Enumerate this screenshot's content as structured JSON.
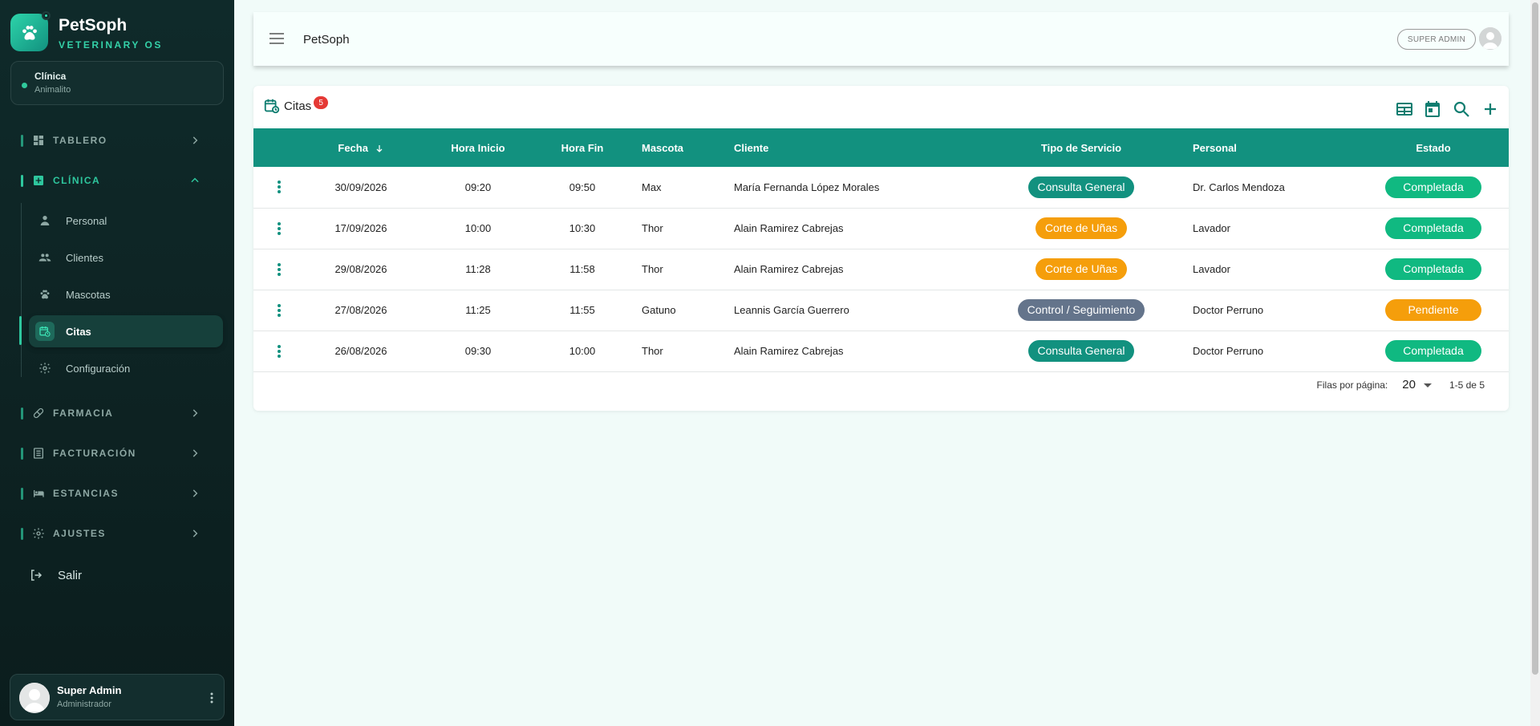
{
  "brand": {
    "name": "PetSoph",
    "subtitle": "VETERINARY OS"
  },
  "clinic": {
    "label": "Clínica",
    "name": "Animalito"
  },
  "nav": {
    "sections": [
      {
        "label": "TABLERO",
        "icon": "dashboard-icon",
        "expanded": false
      },
      {
        "label": "CLÍNICA",
        "icon": "medical-plus-icon",
        "expanded": true
      },
      {
        "label": "FARMACIA",
        "icon": "pill-icon",
        "expanded": false
      },
      {
        "label": "FACTURACIÓN",
        "icon": "receipt-icon",
        "expanded": false
      },
      {
        "label": "ESTANCIAS",
        "icon": "bed-icon",
        "expanded": false
      },
      {
        "label": "AJUSTES",
        "icon": "gear-icon",
        "expanded": false
      }
    ],
    "clinic_items": [
      {
        "label": "Personal",
        "icon": "person-icon"
      },
      {
        "label": "Clientes",
        "icon": "people-icon"
      },
      {
        "label": "Mascotas",
        "icon": "paw-icon"
      },
      {
        "label": "Citas",
        "icon": "calendar-clock-icon",
        "active": true
      },
      {
        "label": "Configuración",
        "icon": "gear-icon"
      }
    ],
    "logout": "Salir"
  },
  "user": {
    "name": "Super Admin",
    "role": "Administrador"
  },
  "topbar": {
    "title": "PetSoph",
    "role_chip": "SUPER ADMIN"
  },
  "card": {
    "title": "Citas",
    "badge": "5",
    "tools": [
      "table-view-icon",
      "calendar-view-icon",
      "search-icon",
      "add-icon"
    ]
  },
  "table": {
    "headers": {
      "fecha": "Fecha",
      "hora_inicio": "Hora Inicio",
      "hora_fin": "Hora Fin",
      "mascota": "Mascota",
      "cliente": "Cliente",
      "tipo": "Tipo de Servicio",
      "personal": "Personal",
      "estado": "Estado"
    },
    "sort": {
      "column": "fecha",
      "direction": "desc"
    },
    "rows": [
      {
        "fecha": "30/09/2026",
        "hora_inicio": "09:20",
        "hora_fin": "09:50",
        "mascota": "Max",
        "cliente": "María Fernanda López Morales",
        "tipo": "Consulta General",
        "tipo_color": "#12917f",
        "personal": "Dr. Carlos Mendoza",
        "estado": "Completada",
        "estado_color": "#10b981"
      },
      {
        "fecha": "17/09/2026",
        "hora_inicio": "10:00",
        "hora_fin": "10:30",
        "mascota": "Thor",
        "cliente": "Alain Ramirez Cabrejas",
        "tipo": "Corte de Uñas",
        "tipo_color": "#f59e0b",
        "personal": "Lavador",
        "estado": "Completada",
        "estado_color": "#10b981"
      },
      {
        "fecha": "29/08/2026",
        "hora_inicio": "11:28",
        "hora_fin": "11:58",
        "mascota": "Thor",
        "cliente": "Alain Ramirez Cabrejas",
        "tipo": "Corte de Uñas",
        "tipo_color": "#f59e0b",
        "personal": "Lavador",
        "estado": "Completada",
        "estado_color": "#10b981"
      },
      {
        "fecha": "27/08/2026",
        "hora_inicio": "11:25",
        "hora_fin": "11:55",
        "mascota": "Gatuno",
        "cliente": "Leannis García Guerrero",
        "tipo": "Control / Seguimiento",
        "tipo_color": "#64748b",
        "personal": "Doctor Perruno",
        "estado": "Pendiente",
        "estado_color": "#f59e0b"
      },
      {
        "fecha": "26/08/2026",
        "hora_inicio": "09:30",
        "hora_fin": "10:00",
        "mascota": "Thor",
        "cliente": "Alain Ramirez Cabrejas",
        "tipo": "Consulta General",
        "tipo_color": "#12917f",
        "personal": "Doctor Perruno",
        "estado": "Completada",
        "estado_color": "#10b981"
      }
    ]
  },
  "pagination": {
    "rows_label": "Filas por página:",
    "rows_per_page": "20",
    "range": "1-5 de 5"
  },
  "colors": {
    "accent": "#12917f",
    "sidebar_bg": "#0f2a2a",
    "active_green": "#2ec79e"
  }
}
